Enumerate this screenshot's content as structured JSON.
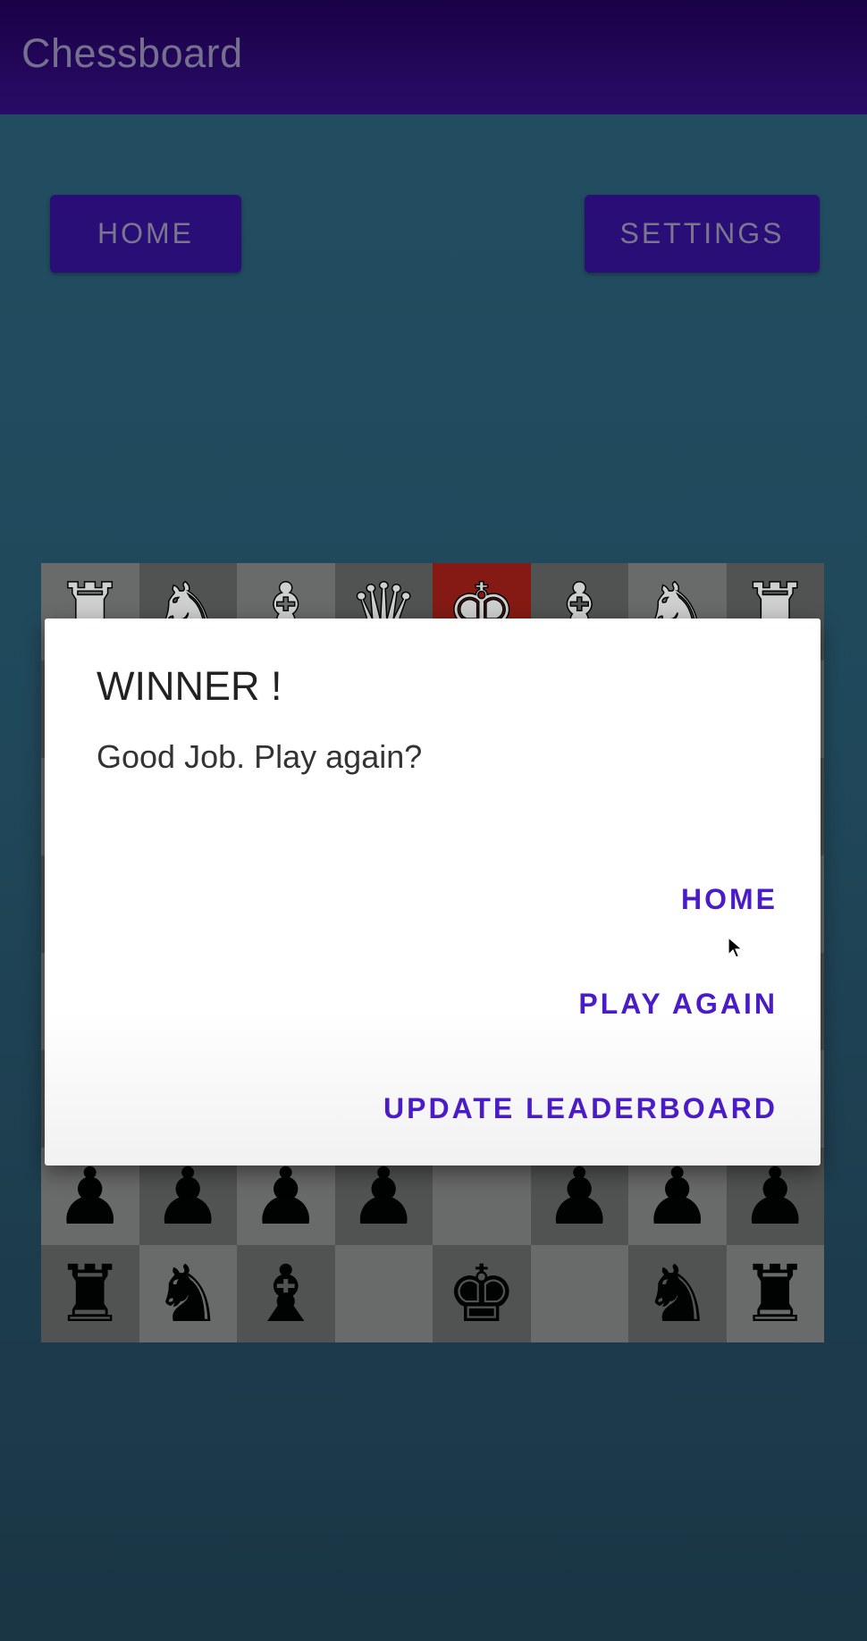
{
  "appbar": {
    "title": "Chessboard"
  },
  "top_buttons": {
    "home_label": "HOME",
    "settings_label": "SETTINGS"
  },
  "board": {
    "rows": [
      [
        "wR",
        "wN",
        "wB",
        "wQ",
        "wK",
        "wB",
        "wN",
        "wR"
      ],
      [
        "",
        "",
        "",
        "",
        "",
        "",
        "",
        ""
      ],
      [
        "",
        "",
        "",
        "",
        "",
        "",
        "",
        ""
      ],
      [
        "",
        "",
        "",
        "",
        "",
        "",
        "",
        ""
      ],
      [
        "",
        "",
        "",
        "",
        "",
        "",
        "",
        ""
      ],
      [
        "",
        "",
        "",
        "",
        "",
        "",
        "",
        ""
      ],
      [
        "bP",
        "bP",
        "bP",
        "bP",
        "",
        "bP",
        "bP",
        "bP"
      ],
      [
        "bR",
        "bN",
        "bB",
        "",
        "bK",
        "",
        "bN",
        "bR"
      ]
    ],
    "highlight_color": "#8b1a12"
  },
  "dialog": {
    "title": "WINNER !",
    "message": "Good Job. Play again?",
    "actions": {
      "home": "HOME",
      "play_again": "PLAY AGAIN",
      "update_leaderboard": "UPDATE LEADERBOARD"
    }
  },
  "colors": {
    "appbar": "#2a0a6c",
    "button": "#2b0d7c",
    "dialog_action": "#4a1cc8",
    "background": "#235064"
  }
}
